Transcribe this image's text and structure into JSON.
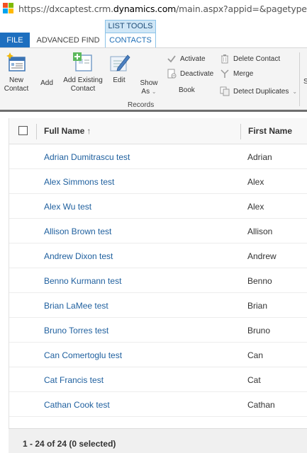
{
  "address_bar": {
    "url_prefix": "https://dxcaptest.crm.",
    "url_domain": "dynamics.com",
    "url_suffix": "/main.aspx?appid=&pagetype=advance",
    "logo_colors": [
      "#f25022",
      "#7fba00",
      "#00a4ef",
      "#ffb900"
    ]
  },
  "tabs": {
    "context_label": "LIST TOOLS",
    "file": "FILE",
    "advanced_find": "ADVANCED FIND",
    "contacts": "CONTACTS"
  },
  "ribbon": {
    "new_contact": "New\nContact",
    "add": "Add",
    "add_existing": "Add Existing\nContact",
    "edit": "Edit",
    "show_as": "Show\nAs",
    "book": "Book",
    "activate": "Activate",
    "deactivate": "Deactivate",
    "delete_contact": "Delete Contact",
    "merge": "Merge",
    "detect_duplicates": "Detect Duplicates",
    "group_label": "Records",
    "overflow": "S"
  },
  "grid": {
    "columns": {
      "full_name": "Full Name",
      "first_name": "First Name"
    },
    "sort_indicator": "↑",
    "rows": [
      {
        "full_name": "Adrian Dumitrascu test",
        "first_name": "Adrian"
      },
      {
        "full_name": "Alex Simmons test",
        "first_name": "Alex"
      },
      {
        "full_name": "Alex Wu test",
        "first_name": "Alex"
      },
      {
        "full_name": "Allison Brown test",
        "first_name": "Allison"
      },
      {
        "full_name": "Andrew Dixon test",
        "first_name": "Andrew"
      },
      {
        "full_name": "Benno Kurmann test",
        "first_name": "Benno"
      },
      {
        "full_name": "Brian LaMee test",
        "first_name": "Brian"
      },
      {
        "full_name": "Bruno Torres test",
        "first_name": "Bruno"
      },
      {
        "full_name": "Can Comertoglu test",
        "first_name": "Can"
      },
      {
        "full_name": "Cat Francis test",
        "first_name": "Cat"
      },
      {
        "full_name": "Cathan Cook test",
        "first_name": "Cathan"
      }
    ],
    "footer": "1 - 24 of 24 (0 selected)"
  }
}
